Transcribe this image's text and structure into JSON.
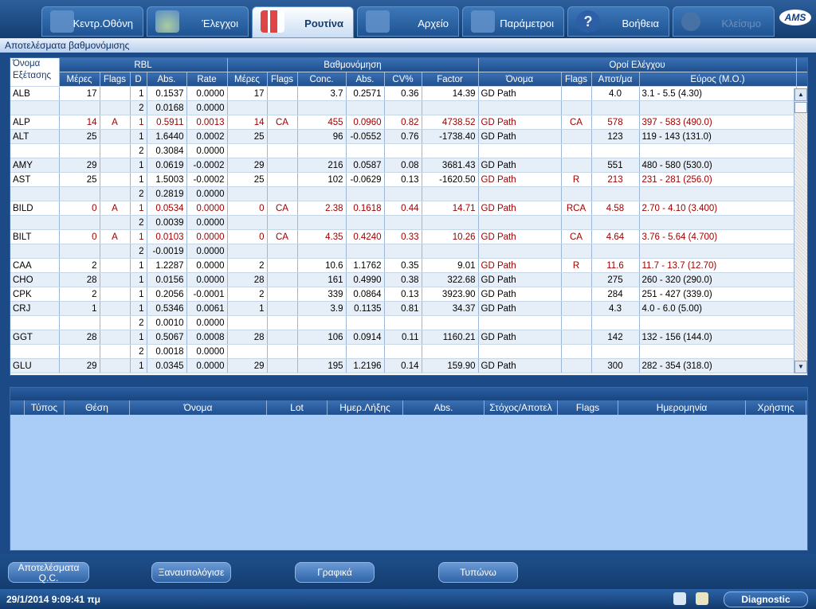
{
  "tabs": [
    {
      "label": "Κεντρ.Οθόνη",
      "icon": "main-screen-icon"
    },
    {
      "label": "Έλεγχοι",
      "icon": "flask-icon"
    },
    {
      "label": "Ρουτίνα",
      "icon": "test-tubes-icon"
    },
    {
      "label": "Αρχείο",
      "icon": "archive-icon"
    },
    {
      "label": "Παράμετροι",
      "icon": "pencil-icon"
    },
    {
      "label": "Βοήθεια",
      "icon": "help-icon"
    },
    {
      "label": "Κλείσιμο",
      "icon": "power-icon"
    }
  ],
  "logo": "AMS",
  "section_title": "Αποτελέσματα βαθμονόμισης",
  "table": {
    "group_headers": {
      "rbl": "RBL",
      "calibration": "Βαθμονόμηση",
      "limits": "Οροί Ελέγχου"
    },
    "test_name_header": [
      "Όνομα",
      "Εξέτασης"
    ],
    "columns": [
      "Μέρες",
      "Flags",
      "D",
      "Abs.",
      "Rate",
      "Μέρες",
      "Flags",
      "Conc.",
      "Abs.",
      "CV%",
      "Factor",
      "Όνομα",
      "Flags",
      "Αποτ/μα",
      "Εύρος (Μ.Ο.)"
    ],
    "rows": [
      [
        "ALB",
        "17",
        "",
        "1",
        "0.1537",
        "0.0000",
        "17",
        "",
        "3.7",
        "0.2571",
        "0.36",
        "14.39",
        "GD Path",
        "",
        "4.0",
        "3.1 - 5.5 (4.30)",
        0
      ],
      [
        "",
        "",
        "",
        "2",
        "0.0168",
        "0.0000",
        "",
        "",
        "",
        "",
        "",
        "",
        "",
        "",
        "",
        "",
        0
      ],
      [
        "ALP",
        "14",
        "A",
        "1",
        "0.5911",
        "0.0013",
        "14",
        "CA",
        "455",
        "0.0960",
        "0.82",
        "4738.52",
        "GD Path",
        "CA",
        "578",
        "397 - 583 (490.0)",
        1
      ],
      [
        "ALT",
        "25",
        "",
        "1",
        "1.6440",
        "0.0002",
        "25",
        "",
        "96",
        "-0.0552",
        "0.76",
        "-1738.40",
        "GD Path",
        "",
        "123",
        "119 - 143 (131.0)",
        0
      ],
      [
        "",
        "",
        "",
        "2",
        "0.3084",
        "0.0000",
        "",
        "",
        "",
        "",
        "",
        "",
        "",
        "",
        "",
        "",
        0
      ],
      [
        "AMY",
        "29",
        "",
        "1",
        "0.0619",
        "-0.0002",
        "29",
        "",
        "216",
        "0.0587",
        "0.08",
        "3681.43",
        "GD Path",
        "",
        "551",
        "480 - 580 (530.0)",
        0
      ],
      [
        "AST",
        "25",
        "",
        "1",
        "1.5003",
        "-0.0002",
        "25",
        "",
        "102",
        "-0.0629",
        "0.13",
        "-1620.50",
        "GD Path",
        "R",
        "213",
        "231 - 281 (256.0)",
        2
      ],
      [
        "",
        "",
        "",
        "2",
        "0.2819",
        "0.0000",
        "",
        "",
        "",
        "",
        "",
        "",
        "",
        "",
        "",
        "",
        0
      ],
      [
        "BILD",
        "0",
        "A",
        "1",
        "0.0534",
        "0.0000",
        "0",
        "CA",
        "2.38",
        "0.1618",
        "0.44",
        "14.71",
        "GD Path",
        "RCA",
        "4.58",
        "2.70 - 4.10 (3.400)",
        1
      ],
      [
        "",
        "",
        "",
        "2",
        "0.0039",
        "0.0000",
        "",
        "",
        "",
        "",
        "",
        "",
        "",
        "",
        "",
        "",
        0
      ],
      [
        "BILT",
        "0",
        "A",
        "1",
        "0.0103",
        "0.0000",
        "0",
        "CA",
        "4.35",
        "0.4240",
        "0.33",
        "10.26",
        "GD Path",
        "CA",
        "4.64",
        "3.76 - 5.64 (4.700)",
        1
      ],
      [
        "",
        "",
        "",
        "2",
        "-0.0019",
        "0.0000",
        "",
        "",
        "",
        "",
        "",
        "",
        "",
        "",
        "",
        "",
        0
      ],
      [
        "CAA",
        "2",
        "",
        "1",
        "1.2287",
        "0.0000",
        "2",
        "",
        "10.6",
        "1.1762",
        "0.35",
        "9.01",
        "GD Path",
        "R",
        "11.6",
        "11.7 - 13.7 (12.70)",
        2
      ],
      [
        "CHO",
        "28",
        "",
        "1",
        "0.0156",
        "0.0000",
        "28",
        "",
        "161",
        "0.4990",
        "0.38",
        "322.68",
        "GD Path",
        "",
        "275",
        "260 - 320 (290.0)",
        0
      ],
      [
        "CPK",
        "2",
        "",
        "1",
        "0.2056",
        "-0.0001",
        "2",
        "",
        "339",
        "0.0864",
        "0.13",
        "3923.90",
        "GD Path",
        "",
        "284",
        "251 - 427 (339.0)",
        0
      ],
      [
        "CRJ",
        "1",
        "",
        "1",
        "0.5346",
        "0.0061",
        "1",
        "",
        "3.9",
        "0.1135",
        "0.81",
        "34.37",
        "GD Path",
        "",
        "4.3",
        "4.0 - 6.0 (5.00)",
        0
      ],
      [
        "",
        "",
        "",
        "2",
        "0.0010",
        "0.0000",
        "",
        "",
        "",
        "",
        "",
        "",
        "",
        "",
        "",
        "",
        0
      ],
      [
        "GGT",
        "28",
        "",
        "1",
        "0.5067",
        "0.0008",
        "28",
        "",
        "106",
        "0.0914",
        "0.11",
        "1160.21",
        "GD Path",
        "",
        "142",
        "132 - 156 (144.0)",
        0
      ],
      [
        "",
        "",
        "",
        "2",
        "0.0018",
        "0.0000",
        "",
        "",
        "",
        "",
        "",
        "",
        "",
        "",
        "",
        "",
        0
      ],
      [
        "GLU",
        "29",
        "",
        "1",
        "0.0345",
        "0.0000",
        "29",
        "",
        "195",
        "1.2196",
        "0.14",
        "159.90",
        "GD Path",
        "",
        "300",
        "282 - 354 (318.0)",
        0
      ]
    ]
  },
  "lower_table": {
    "columns": [
      "Τύπος",
      "Θέση",
      "Όνομα",
      "Lot",
      "Ημερ.Λήξης",
      "Abs.",
      "Στόχος/Αποτελ",
      "Flags",
      "Ημερομηνία",
      "Χρήστης"
    ]
  },
  "footer": {
    "qc_results": "Αποτελέσματα Q.C.",
    "recalc": "Ξαναυπολόγισε",
    "graphs": "Γραφικά",
    "print": "Τυπώνω"
  },
  "status": {
    "datetime": "29/1/2014  9:09:41 πμ",
    "mode": "Diagnostic"
  }
}
